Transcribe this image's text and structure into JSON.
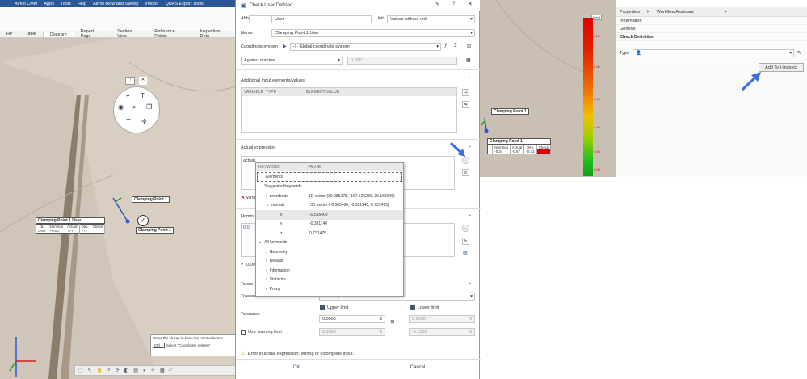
{
  "app": {
    "menu": [
      "Airfoil CMM",
      "Apps",
      "Tools",
      "Help",
      "Airfoil Blow and Sweep",
      "eMotor",
      "QDAS Export Tools"
    ],
    "view_tabs": [
      "HP",
      "Table",
      "Diagram",
      "Report Page",
      "Section View",
      "Reference Points",
      "Inspection Deta"
    ],
    "active_view_tab": "Diagram"
  },
  "viewport": {
    "circle_menu_up": "↑",
    "circle_menu_close": "✕",
    "label_user": "Clamping Point 1.User",
    "label_point_1": "Clamping Point 1",
    "label_point_2": "Clamping Point 1",
    "meas_headers": [
      "dL",
      "Nominal",
      "Actual",
      "Dev.",
      "Check"
    ],
    "meas_values": [
      "User",
      "+0.00",
      "???",
      "???",
      ""
    ],
    "hint_line1": "Press the Alt key to keep the point selection",
    "hint_key": "Ctrl +",
    "hint_line2": "Select \"Coordinate system\""
  },
  "dialog": {
    "title": "Check User Defined",
    "abbreviation_label": "Abbreviation",
    "abbreviation_value": "User",
    "unit_label": "Unit",
    "unit_value": "Values without unit",
    "name_label": "Name",
    "name_value": "Clamping Point 1.User",
    "coord_label": "Coordinate system",
    "coord_value": "Global coordinate system",
    "against_value": "Against nominal",
    "against_number": "0.000",
    "additional_title": "Additional input elements/values",
    "var_headers": [
      "VARIABLE",
      "TYPE",
      "ELEMENT/VALUE"
    ],
    "actual_title": "Actual expression",
    "actual_text": "actual.",
    "error_short": "Wron",
    "nominal_title": "Nomin",
    "nominal_value": "0.0",
    "nominal_status": "0.00",
    "tolerance_title": "Tolera",
    "tolerance_source_label": "Tolerance source",
    "tolerance_source_value": "Manually",
    "tolerance_label": "Tolerance",
    "upper_label": "Upper limit",
    "lower_label": "Lower limit",
    "upper_value": "0.0000",
    "lower_value": "0.0000",
    "warning_label": "Use warning limit",
    "warn_upper": "0.1000",
    "warn_lower": "-0.1000",
    "error_message": "Error in actual expression: Wrong or incomplete input.",
    "ok_label": "OK",
    "cancel_label": "Cancel"
  },
  "popup": {
    "headers": [
      "KEYWORD",
      "VALUE"
    ],
    "elements": "Elements",
    "suggested": "Suggested keywords",
    "coordinate": "coordinate",
    "coordinate_value": "3D vector (39.985278, -197.525289, 35.163046)",
    "normal": "normal",
    "normal_value": "3D vector (-0.565400, -0.381140, 0.731475)",
    "x": "x",
    "x_value": "-0.565400",
    "y": "y",
    "y_value": "-0.381140",
    "z": "z",
    "z_value": "0.731475",
    "all": "All keywords",
    "groups": [
      "Geometry",
      "Results",
      "Information",
      "Statistics",
      "Proxy"
    ]
  },
  "right_panel": {
    "tabs": [
      "Properties",
      "Workflow Assistant",
      "+"
    ],
    "items": [
      "Information",
      "General",
      "Check Definition"
    ],
    "type_label": "Type",
    "type_value": "–",
    "add_button": "Add To I-Inspect",
    "colorbar_unit": "[mm]",
    "colorbar_labels": [
      "0.25",
      "0.20",
      "0.15",
      "0.10",
      "0.05",
      "0.00"
    ],
    "label_point": "Clamping Point 1",
    "meas_title": "Clamping Point 1",
    "meas_headers": [
      "I",
      "Nominal",
      "Actual",
      "Dev.",
      "Check"
    ],
    "meas_values": [
      "I",
      "-0.24",
      "-0.57",
      "-0.33",
      ""
    ]
  },
  "colors": {
    "accent": "#2b5797",
    "arrow": "#3b6fe0",
    "error": "#d9322e",
    "ok": "#2e9e3e"
  }
}
